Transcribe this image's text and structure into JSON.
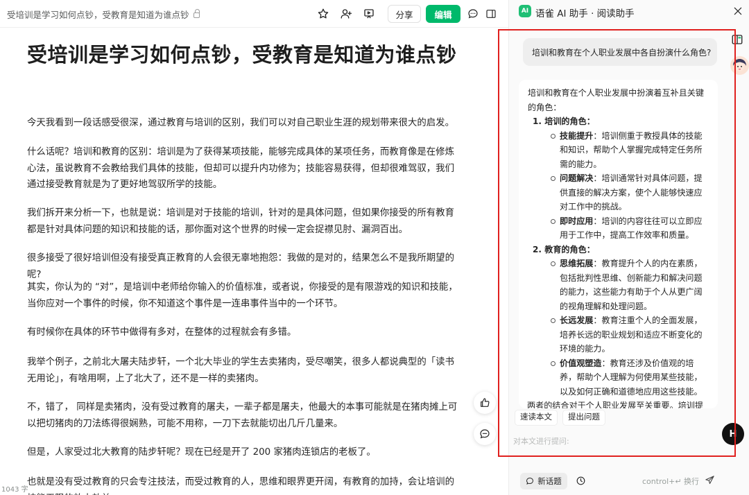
{
  "toolbar": {
    "doc_title": "受培训是学习如何点钞，受教育是知道为谁点钞",
    "share_label": "分享",
    "edit_label": "编辑"
  },
  "article": {
    "title": "受培训是学习如何点钞，受教育是知道为谁点钞",
    "paragraphs": [
      "今天我看到一段话感受很深，通过教育与培训的区别，我们可以对自己职业生涯的规划带来很大的启发。",
      "什么话呢？培训和教育的区别：培训是为了获得某项技能，能够完成具体的某项任务，而教育像是在修炼心法，虽说教育不会教给我们具体的技能，但却可以提升内功修为；技能容易获得，但却很难驾驭，我们通过接受教育就是为了更好地驾驭所学的技能。",
      "我们拆开来分析一下，也就是说：培训是对于技能的培训，针对的是具体问题，但如果你接受的所有教育都是针对具体问题的知识和技能的话，那你面对这个世界的时候一定会捉襟见肘、漏洞百出。",
      "很多接受了很好培训但没有接受真正教育的人会很无辜地抱怨：我做的是对的，结果怎么不是我所期望的呢?",
      "其实，你认为的 “对”，是培训中老师给你输入的价值标准，或者说，你接受的是有限游戏的知识和技能，当你应对一个事件的时候，你不知道这个事件是一连串事件当中的一个环节。",
      "有时候你在具体的环节中做得有多对，在整体的过程就会有多错。",
      "我举个例子，之前北大屠夫陆步轩，一个北大毕业的学生去卖猪肉，受尽嘲笑，很多人都说典型的「读书无用论」，有啥用啊，上了北大了，还不是一样的卖猪肉。",
      "不，错了， 同样是卖猪肉，没有受过教育的屠夫，一辈子都是屠夫，他最大的本事可能就是在猪肉摊上可以把切猪肉的刀法练得很娴熟，可能不用称，一刀下去就能切出几斤几量来。",
      "但是，人家受过北大教育的陆步轩呢？现在已经是开了 200 家猪肉连锁店的老板了。",
      "也就是没有受过教育的只会专注技法，而受过教育的人，思维和眼界更开阔，有教育的加持，会让培训的技能无限的放大效益。"
    ],
    "word_count": "1043 字"
  },
  "assistant": {
    "logo_text": "AI",
    "title": "语雀 AI 助手 · 阅读助手",
    "question": "培训和教育在个人职业发展中各自扮演什么角色?",
    "answer": {
      "intro": "培训和教育在个人职业发展中扮演着互补且关键的角色：",
      "sections": [
        {
          "title": "1. 培训的角色：",
          "items": [
            {
              "term": "技能提升",
              "text": "：培训侧重于教授具体的技能和知识，帮助个人掌握完成特定任务所需的能力。"
            },
            {
              "term": "问题解决",
              "text": "：培训通常针对具体问题，提供直接的解决方案，使个人能够快速应对工作中的挑战。"
            },
            {
              "term": "即时应用",
              "text": "：培训的内容往往可以立即应用于工作中，提高工作效率和质量。"
            }
          ]
        },
        {
          "title": "2. 教育的角色：",
          "items": [
            {
              "term": "思维拓展",
              "text": "：教育提升个人的内在素质，包括批判性思维、创新能力和解决问题的能力，这些能力有助于个人从更广阔的视角理解和处理问题。"
            },
            {
              "term": "长远发展",
              "text": "：教育注重个人的全面发展，培养长远的职业规划和适应不断变化的环境的能力。"
            },
            {
              "term": "价值观塑造",
              "text": "：教育还涉及价值观的培养，帮助个人理解为何使用某些技能，以及如何正确和道德地应用这些技能。"
            }
          ]
        }
      ],
      "conclusion": "两者的结合对于个人职业发展至关重要。培训提"
    },
    "chips": [
      "速读本文",
      "提出问题"
    ],
    "input_placeholder": "对本文进行提问:",
    "new_topic_label": "新话题",
    "send_hint": "control+↵ 换行",
    "h_button": "H"
  },
  "colors": {
    "brand_green": "#00b96b",
    "highlight_frame": "#e0201e"
  }
}
